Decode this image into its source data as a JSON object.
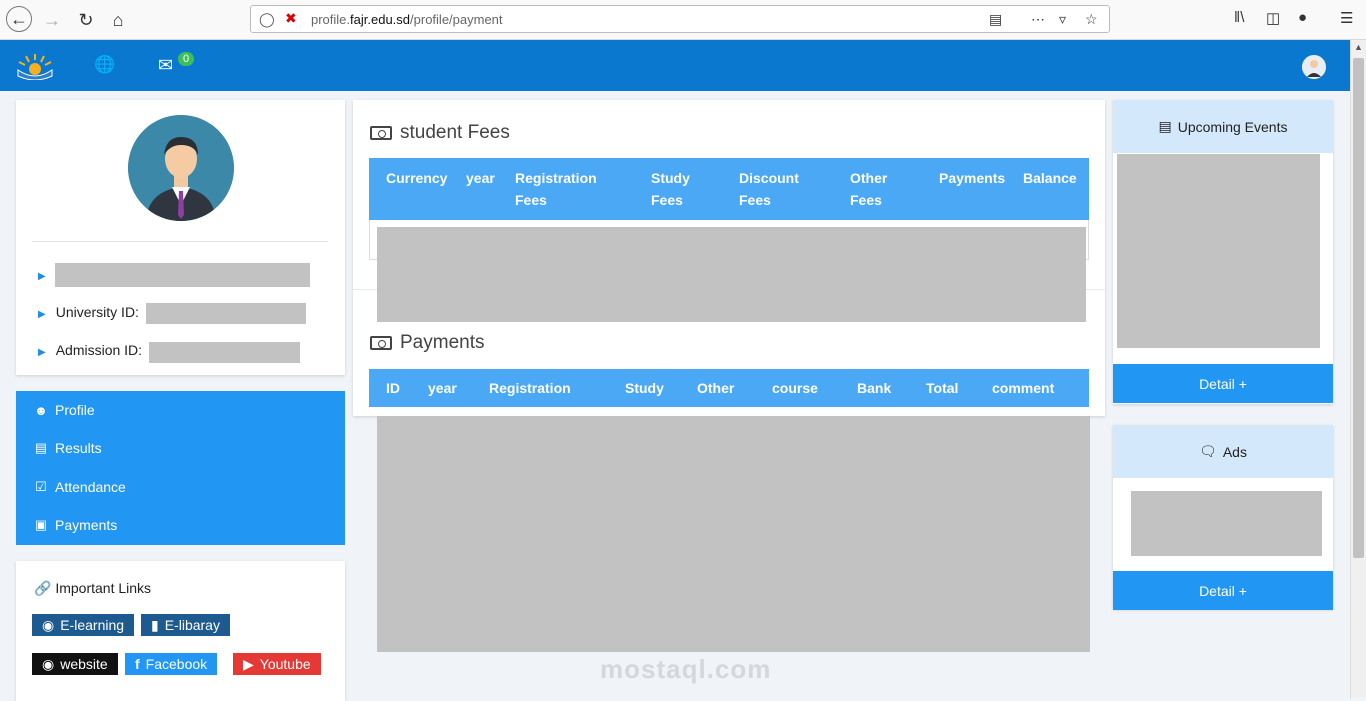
{
  "browser": {
    "url_domain_prefix": "profile.",
    "url_domain": "fajr.edu.sd",
    "url_path": "/profile/payment"
  },
  "header": {
    "mail_count": "0"
  },
  "profile": {
    "university_id_label": "University ID:",
    "admission_id_label": "Admission ID:"
  },
  "menu": {
    "items": [
      {
        "label": "Profile",
        "icon": "user-circle-icon"
      },
      {
        "label": "Results",
        "icon": "file-icon"
      },
      {
        "label": "Attendance",
        "icon": "calendar-check-icon"
      },
      {
        "label": "Payments",
        "icon": "money-icon"
      }
    ]
  },
  "links": {
    "title": "Important Links",
    "buttons": [
      {
        "label": "E-learning",
        "color": "#1c5a8f"
      },
      {
        "label": "E-libaray",
        "color": "#1c5a8f"
      },
      {
        "label": "website",
        "color": "#111111"
      },
      {
        "label": "Facebook",
        "color": "#2196f3"
      },
      {
        "label": "Youtube",
        "color": "#e53935"
      }
    ]
  },
  "fees": {
    "title": "student Fees",
    "columns": [
      "Currency",
      "year",
      "Registration Fees",
      "Study Fees",
      "Discount Fees",
      "Other Fees",
      "Payments",
      "Balance"
    ],
    "col_lines": [
      [
        "Currency"
      ],
      [
        "year"
      ],
      [
        "Registration",
        "Fees"
      ],
      [
        "Study",
        "Fees"
      ],
      [
        "Discount",
        "Fees"
      ],
      [
        "Other",
        "Fees"
      ],
      [
        "Payments"
      ],
      [
        "Balance"
      ]
    ]
  },
  "payments": {
    "title": "Payments",
    "columns": [
      "ID",
      "year",
      "Registration",
      "Study",
      "Other",
      "course",
      "Bank",
      "Total",
      "comment"
    ]
  },
  "events": {
    "title": "Upcoming Events",
    "detail_label": "Detail +"
  },
  "ads": {
    "title": "Ads",
    "detail_label": "Detail +"
  },
  "watermark": "mostaql.com",
  "colors": {
    "appbar": "#0b78d0",
    "menu": "#2196f3",
    "table_header": "#4aa8f5",
    "side_header": "#d3e8fb"
  }
}
